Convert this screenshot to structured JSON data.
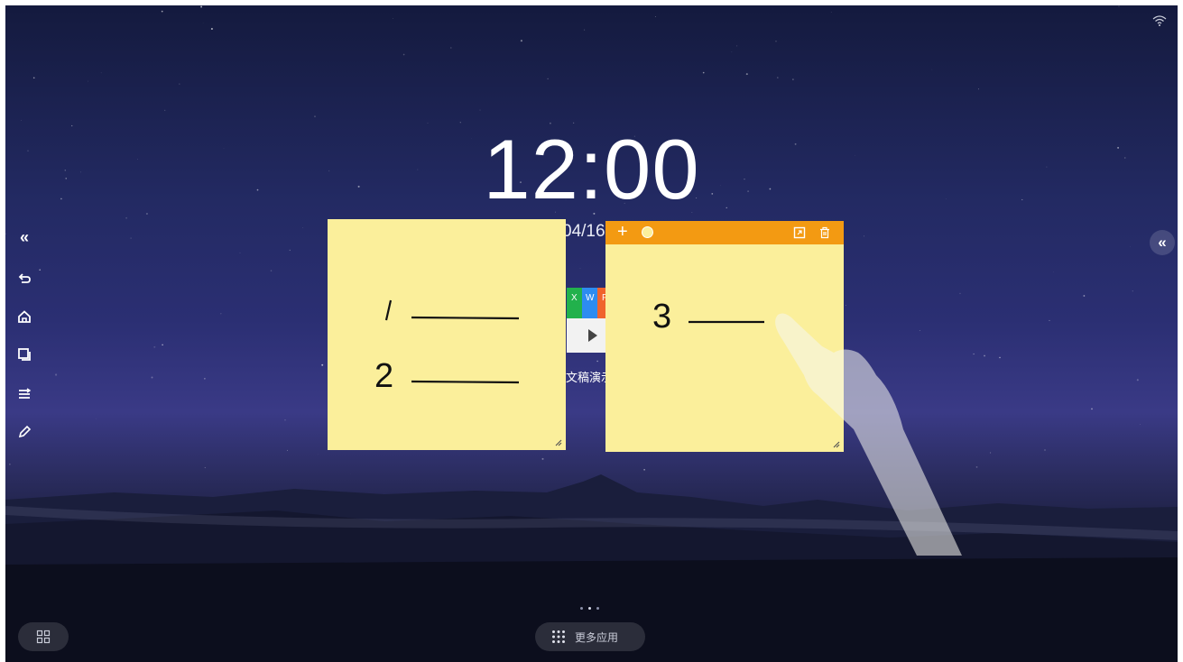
{
  "clock": {
    "time": "12:00",
    "date": "04/16"
  },
  "status": {
    "wifi_icon": "wifi-icon"
  },
  "left_toolbar": {
    "items": [
      {
        "name": "collapse-left-icon",
        "glyph": "«"
      },
      {
        "name": "back-icon"
      },
      {
        "name": "home-icon"
      },
      {
        "name": "window-switch-icon"
      },
      {
        "name": "menu-icon"
      },
      {
        "name": "pen-icon"
      }
    ]
  },
  "right_toolbar": {
    "collapse_glyph": "«"
  },
  "sticky_notes": [
    {
      "lines": [
        "1",
        "2"
      ]
    },
    {
      "lines": [
        "3"
      ],
      "toolbar": {
        "add": "+",
        "icons": [
          "add-note-icon",
          "color-icon",
          "expand-icon",
          "delete-icon"
        ]
      }
    }
  ],
  "app_shortcut": {
    "label": "文稿演示",
    "tiles": [
      "X",
      "W",
      "P"
    ]
  },
  "dock": {
    "more_apps_label": "更多应用",
    "pager_count": 3,
    "pager_active": 2
  },
  "colors": {
    "note": "#fbef9b",
    "note_bar": "#f39a12",
    "sky": "#2b2f73"
  }
}
